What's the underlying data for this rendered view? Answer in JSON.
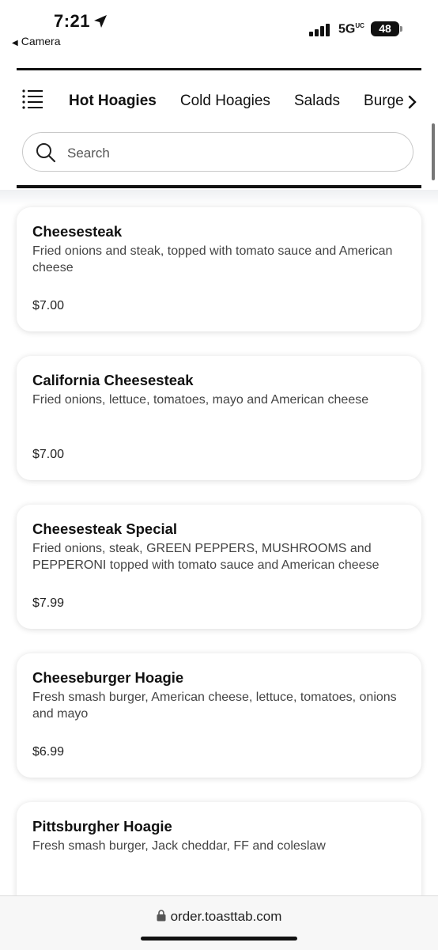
{
  "status_bar": {
    "time": "7:21",
    "back_app": "Camera",
    "network": "5G",
    "network_suffix": "UC",
    "battery": "48"
  },
  "header": {
    "tabs": [
      "Hot Hoagies",
      "Cold Hoagies",
      "Salads",
      "Burgers"
    ],
    "active_tab": "Hot Hoagies"
  },
  "search": {
    "placeholder": "Search"
  },
  "menu_items": [
    {
      "name": "Cheesesteak",
      "description": "Fried onions and steak, topped with tomato sauce and American cheese",
      "price": "$7.00"
    },
    {
      "name": "California Cheesesteak",
      "description": "Fried onions, lettuce, tomatoes, mayo and American cheese",
      "price": "$7.00"
    },
    {
      "name": "Cheesesteak Special",
      "description": "Fried onions, steak, GREEN PEPPERS, MUSHROOMS and PEPPERONI topped with tomato sauce and American cheese",
      "price": "$7.99"
    },
    {
      "name": "Cheeseburger Hoagie",
      "description": "Fresh smash burger, American cheese, lettuce, tomatoes, onions and mayo",
      "price": "$6.99"
    },
    {
      "name": "Pittsburgher Hoagie",
      "description": "Fresh smash burger, Jack cheddar, FF and coleslaw",
      "price": ""
    }
  ],
  "browser": {
    "url": "order.toasttab.com"
  },
  "icons": {
    "menu": "list-menu-icon",
    "search": "search-icon",
    "next": "chevron-right-icon",
    "lock": "lock-icon",
    "location": "location-arrow-icon"
  }
}
